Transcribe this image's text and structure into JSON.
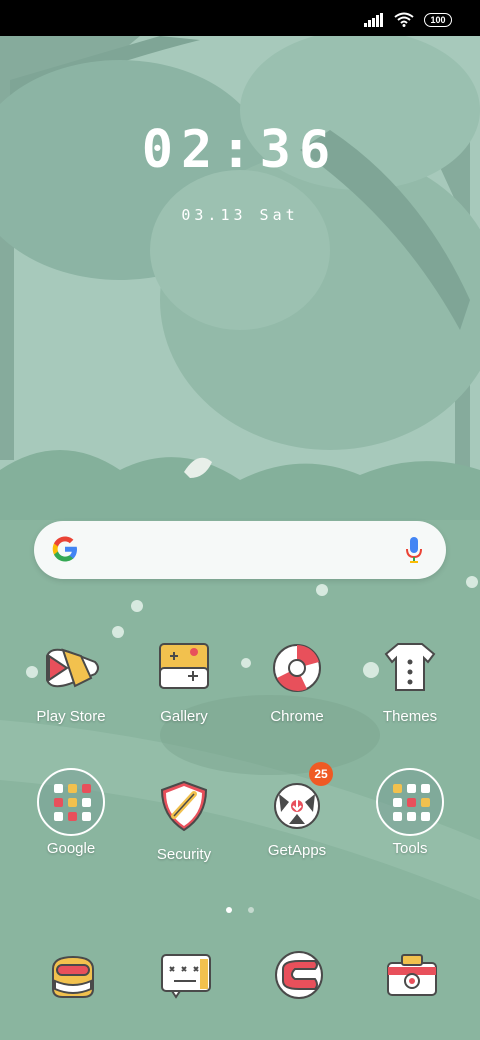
{
  "status_bar": {
    "battery": "100",
    "icons": [
      "signal-icon",
      "wifi-icon",
      "battery-icon"
    ]
  },
  "lock_clock": {
    "time": "02:36",
    "date": "03.13  Sat"
  },
  "search": {
    "icons": [
      "google-g-icon",
      "microphone-icon"
    ]
  },
  "apps_row1": [
    {
      "label": "Play Store",
      "icon": "play-store-icon"
    },
    {
      "label": "Gallery",
      "icon": "gallery-icon"
    },
    {
      "label": "Chrome",
      "icon": "chrome-icon"
    },
    {
      "label": "Themes",
      "icon": "themes-icon"
    }
  ],
  "apps_row2": [
    {
      "label": "Google",
      "icon": "google-folder-icon"
    },
    {
      "label": "Security",
      "icon": "security-icon"
    },
    {
      "label": "GetApps",
      "icon": "getapps-icon",
      "badge": "25"
    },
    {
      "label": "Tools",
      "icon": "tools-folder-icon"
    }
  ],
  "page_indicator": {
    "pages": 2,
    "current": 1
  },
  "dock": [
    "phone-icon",
    "messages-icon",
    "browser-icon",
    "camera-icon"
  ],
  "colors": {
    "wallpaper": "#8fb8a6",
    "badge": "#ef5a24",
    "accent_red": "#e8505b",
    "accent_yellow": "#f2c14e"
  }
}
